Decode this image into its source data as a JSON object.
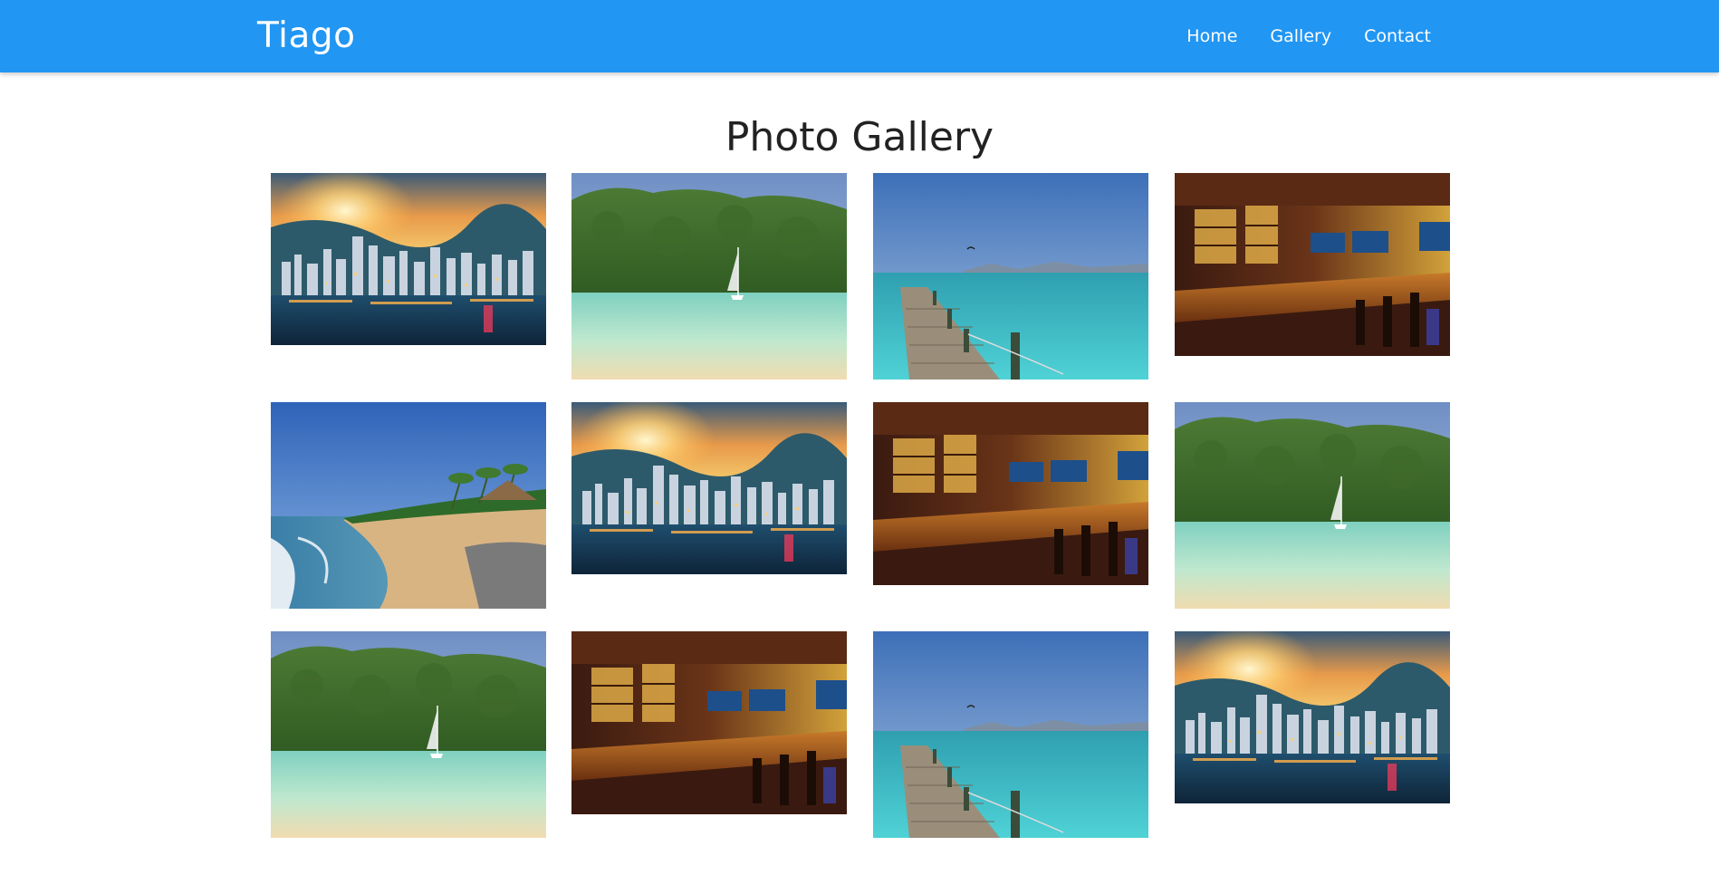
{
  "navbar": {
    "brand": "Tiago",
    "links": [
      "Home",
      "Gallery",
      "Contact"
    ],
    "background": "#2196f3"
  },
  "main": {
    "title": "Photo Gallery"
  },
  "gallery": {
    "rows": [
      [
        "city-sunset",
        "sailboat-bay",
        "pier-sea",
        "bar-interior"
      ],
      [
        "tropical-beach",
        "city-sunset",
        "bar-interior",
        "sailboat-bay"
      ],
      [
        "sailboat-bay",
        "bar-interior",
        "pier-sea",
        "city-sunset"
      ]
    ]
  }
}
